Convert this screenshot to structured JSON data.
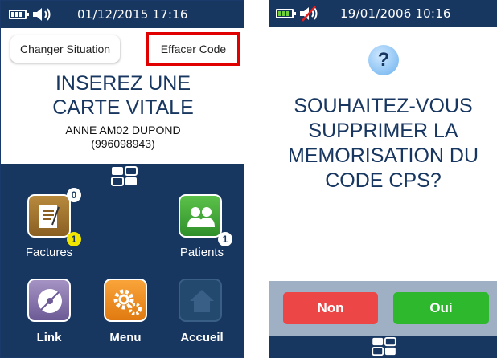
{
  "left_screen": {
    "status": {
      "datetime": "01/12/2015 17:16"
    },
    "buttons": {
      "changer": "Changer Situation",
      "effacer": "Effacer Code"
    },
    "title": {
      "line1": "INSEREZ UNE",
      "line2": "CARTE VITALE"
    },
    "holder": {
      "name": "ANNE AM02 DUPOND",
      "number": "(996098943)"
    },
    "apps": [
      {
        "label": "Factures",
        "badge_top": "0",
        "badge_bottom": "1"
      },
      {
        "label": "Patients",
        "badge_bottom": "1"
      },
      {
        "label": "Link"
      },
      {
        "label": "Menu"
      },
      {
        "label": "Accueil"
      }
    ]
  },
  "right_screen": {
    "status": {
      "datetime": "19/01/2006 10:16"
    },
    "question_icon": "?",
    "question": {
      "line1": "SOUHAITEZ-VOUS",
      "line2": "SUPPRIMER LA",
      "line3": "MEMORISATION DU",
      "line4": "CODE CPS?"
    },
    "buttons": {
      "no": "Non",
      "yes": "Oui"
    }
  },
  "colors": {
    "navy": "#173660",
    "highlight_red": "#e00000",
    "no_red": "#ec4646",
    "yes_green": "#2eb82e",
    "badge_yellow": "#f2e600"
  },
  "icons": [
    "battery-icon",
    "speaker-icon",
    "speaker-muted-icon",
    "grid-icon",
    "invoice-icon",
    "patients-icon",
    "link-disc-icon",
    "gears-icon",
    "home-icon",
    "question-icon"
  ]
}
